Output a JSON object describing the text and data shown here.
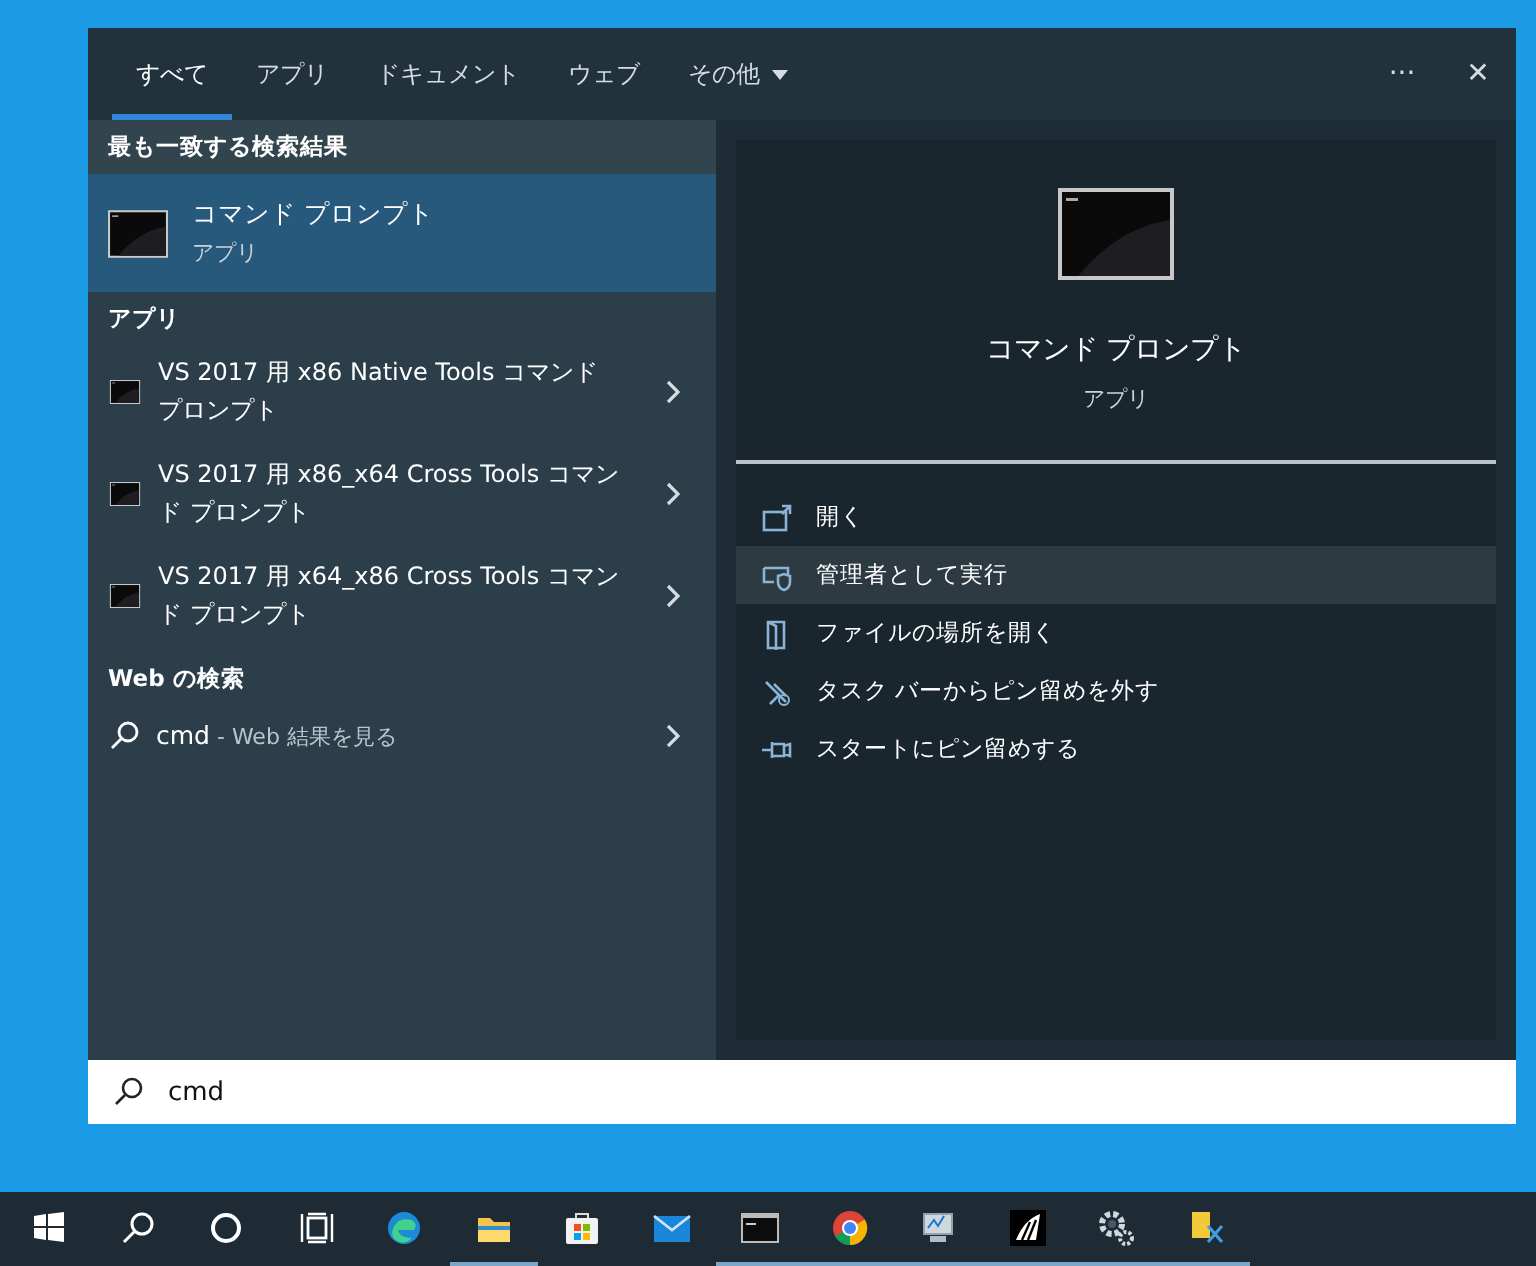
{
  "tabs": [
    {
      "label": "すべて",
      "selected": true,
      "kind": "tab"
    },
    {
      "label": "アプリ",
      "selected": false,
      "kind": "tab"
    },
    {
      "label": "ドキュメント",
      "selected": false,
      "kind": "tab"
    },
    {
      "label": "ウェブ",
      "selected": false,
      "kind": "tab"
    },
    {
      "label": "その他",
      "selected": false,
      "kind": "dropdown"
    }
  ],
  "header_buttons": {
    "more": "···",
    "close": "✕"
  },
  "best_match": {
    "heading": "最も一致する検索結果",
    "title": "コマンド プロンプト",
    "subtitle": "アプリ",
    "selected": true
  },
  "apps": {
    "heading": "アプリ",
    "items": [
      {
        "label": "VS 2017 用 x86 Native Tools コマンドプロンプト"
      },
      {
        "label": "VS 2017 用 x86_x64 Cross Tools コマンド プロンプト"
      },
      {
        "label": "VS 2017 用 x64_x86 Cross Tools コマンド プロンプト"
      }
    ]
  },
  "web": {
    "heading": "Web の検索",
    "query": "cmd",
    "suffix": " - Web 結果を見る"
  },
  "details": {
    "title": "コマンド プロンプト",
    "subtitle": "アプリ",
    "actions": [
      {
        "kind": "open",
        "label": "開く",
        "selected": false
      },
      {
        "kind": "admin",
        "label": "管理者として実行",
        "selected": true
      },
      {
        "kind": "folder",
        "label": "ファイルの場所を開く",
        "selected": false
      },
      {
        "kind": "unpin",
        "label": "タスク バーからピン留めを外す",
        "selected": false
      },
      {
        "kind": "pin",
        "label": "スタートにピン留めする",
        "selected": false
      }
    ]
  },
  "search": {
    "value": "cmd"
  },
  "taskbar": {
    "items": [
      {
        "kind": "start",
        "running": false
      },
      {
        "kind": "search",
        "running": false
      },
      {
        "kind": "cortana",
        "running": false
      },
      {
        "kind": "taskview",
        "running": false
      },
      {
        "kind": "edge",
        "running": false
      },
      {
        "kind": "explorer",
        "running": true
      },
      {
        "kind": "store",
        "running": false
      },
      {
        "kind": "mail",
        "running": false
      },
      {
        "kind": "terminal",
        "running": true
      },
      {
        "kind": "chrome",
        "running": true
      },
      {
        "kind": "monitor",
        "running": true
      },
      {
        "kind": "sails",
        "running": true
      },
      {
        "kind": "gear",
        "running": true
      },
      {
        "kind": "snip",
        "running": true
      }
    ]
  }
}
